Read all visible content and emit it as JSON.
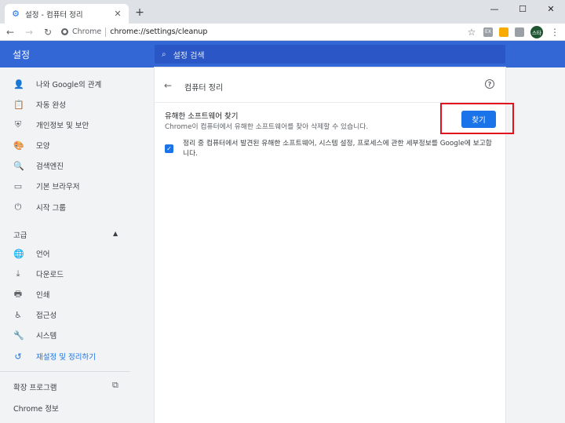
{
  "browser": {
    "tab_title": "설정 - 컴퓨터 정리",
    "tab_icon": "settings-gear-icon",
    "close_glyph": "✕",
    "new_tab_glyph": "+",
    "window_controls": [
      "—",
      "☐",
      "✕"
    ]
  },
  "toolbar": {
    "site_chip": "Chrome",
    "url": "chrome://settings/cleanup",
    "extensions": [
      {
        "name": "ext-gray-icon",
        "color": "#9aa0a6",
        "text": "EX"
      },
      {
        "name": "ext-folder-icon",
        "color": "#f9ab00",
        "text": ""
      },
      {
        "name": "ext-screen-icon",
        "color": "#9aa0a6",
        "text": ""
      }
    ],
    "avatar_text": "스타"
  },
  "header": {
    "title": "설정",
    "search_placeholder": "설정 검색"
  },
  "sidebar": {
    "items": [
      {
        "label": "나와 Google의 관계",
        "icon": "person-icon"
      },
      {
        "label": "자동 완성",
        "icon": "clipboard-icon"
      },
      {
        "label": "개인정보 및 보안",
        "icon": "shield-icon"
      },
      {
        "label": "모양",
        "icon": "palette-icon"
      },
      {
        "label": "검색엔진",
        "icon": "search-icon"
      },
      {
        "label": "기본 브라우저",
        "icon": "browser-window-icon"
      },
      {
        "label": "시작 그룹",
        "icon": "power-icon"
      }
    ],
    "advanced_label": "고급",
    "advanced_items": [
      {
        "label": "언어",
        "icon": "globe-icon"
      },
      {
        "label": "다운로드",
        "icon": "download-icon"
      },
      {
        "label": "인쇄",
        "icon": "printer-icon"
      },
      {
        "label": "접근성",
        "icon": "accessibility-icon"
      },
      {
        "label": "시스템",
        "icon": "wrench-icon"
      },
      {
        "label": "재설정 및 정리하기",
        "icon": "reset-icon",
        "active": true
      }
    ],
    "extensions_label": "확장 프로그램",
    "about_label": "Chrome 정보"
  },
  "main": {
    "page_title": "컴퓨터 정리",
    "find_title": "유해한 소프트웨어 찾기",
    "find_description": "Chrome이 컴퓨터에서 유해한 소프트웨어를 찾아 삭제할 수 있습니다.",
    "find_button": "찾기",
    "report_checked": true,
    "report_text": "정리 중 컴퓨터에서 발견된 유해한 소프트웨어, 시스템 설정, 프로세스에 관한 세부정보를 Google에 보고합니다."
  },
  "colors": {
    "accent": "#1a73e8",
    "header_blue": "#3367d6",
    "highlight_red": "#e3101e"
  }
}
